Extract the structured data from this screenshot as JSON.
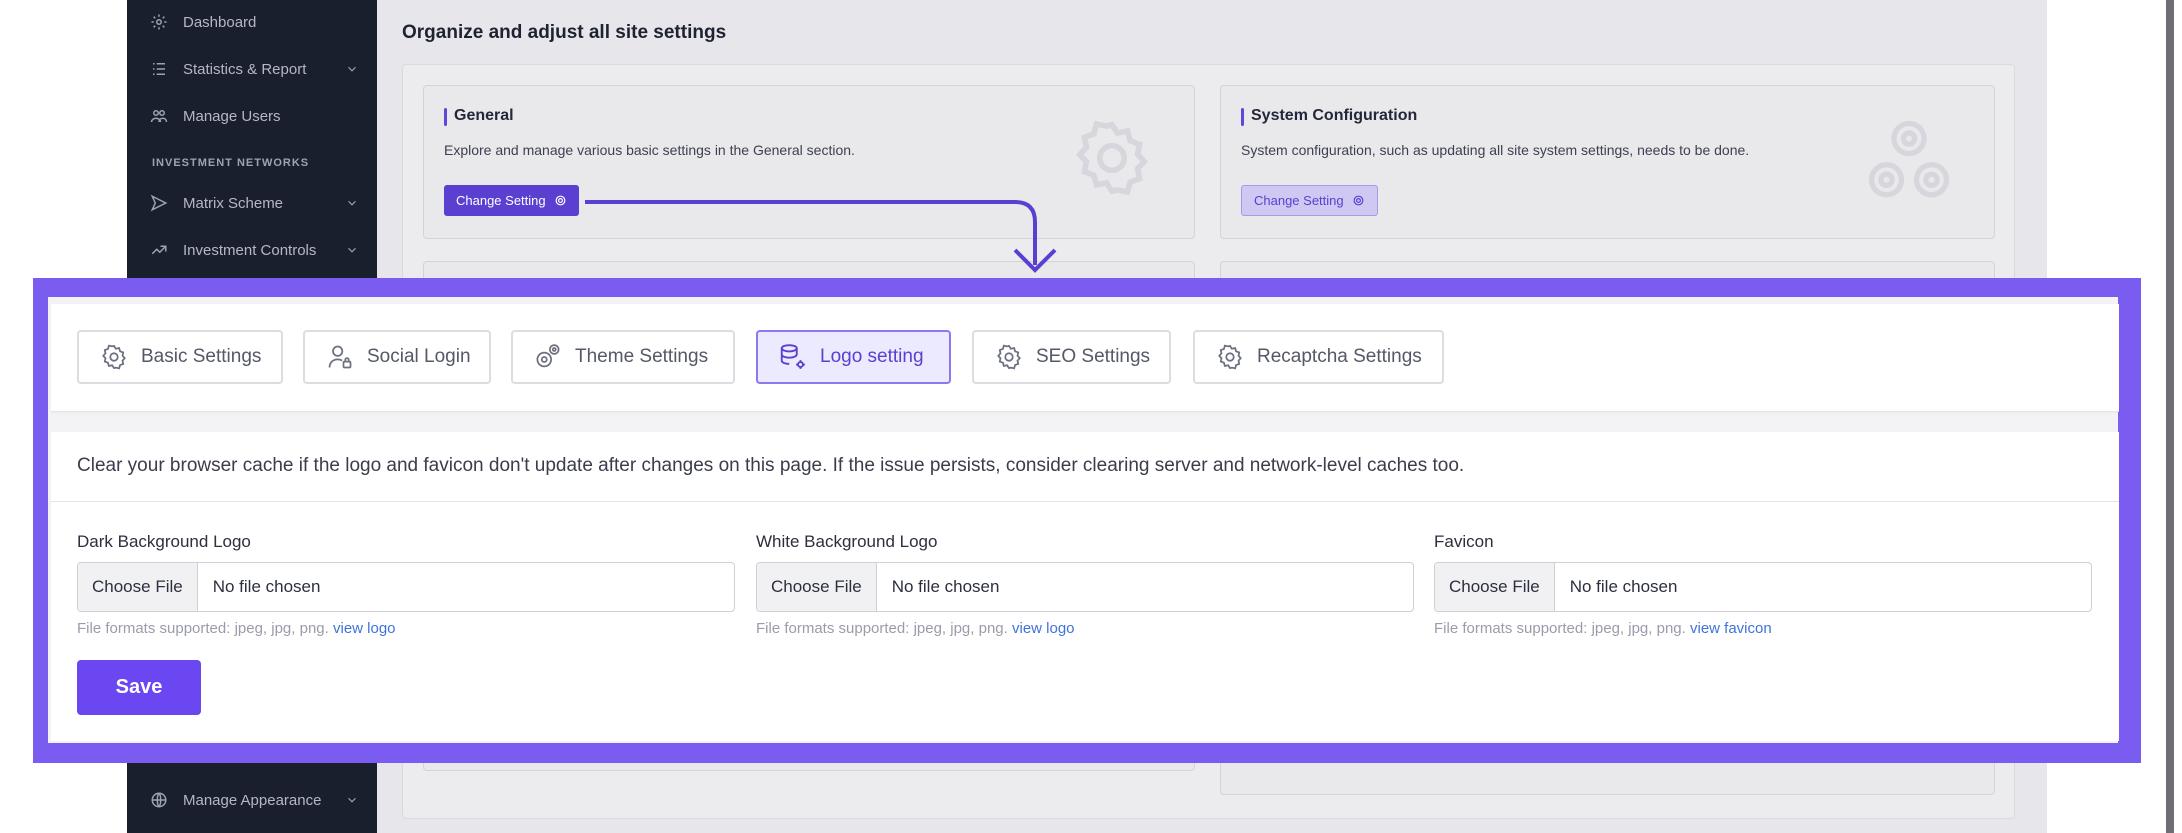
{
  "sidebar": {
    "items": [
      {
        "label": "Dashboard",
        "icon": "gear-icon",
        "chevron": false
      },
      {
        "label": "Statistics & Report",
        "icon": "list-icon",
        "chevron": true
      },
      {
        "label": "Manage Users",
        "icon": "users-icon",
        "chevron": false
      },
      {
        "label": "Matrix Scheme",
        "icon": "send-icon",
        "chevron": true
      },
      {
        "label": "Investment Controls",
        "icon": "investment-icon",
        "chevron": true
      },
      {
        "label": "Manage Appearance",
        "icon": "globe-icon",
        "chevron": true
      }
    ],
    "section_heading": "INVESTMENT NETWORKS"
  },
  "main": {
    "title": "Organize and adjust all site settings",
    "cards": [
      {
        "title": "General",
        "description": "Explore and manage various basic settings in the General section.",
        "button_label": "Change Setting",
        "icon": "gear-icon"
      },
      {
        "title": "System Configuration",
        "description": "System configuration, such as updating all site system settings, needs to be done.",
        "button_label": "Change Setting",
        "icon": "gears-icon"
      }
    ]
  },
  "settings": {
    "tabs": [
      {
        "label": "Basic Settings",
        "icon": "gear-icon",
        "active": false
      },
      {
        "label": "Social Login",
        "icon": "user-lock-icon",
        "active": false
      },
      {
        "label": "Theme Settings",
        "icon": "gears-icon",
        "active": false
      },
      {
        "label": "Logo setting",
        "icon": "database-gear-icon",
        "active": true
      },
      {
        "label": "SEO Settings",
        "icon": "gear-icon",
        "active": false
      },
      {
        "label": "Recaptcha Settings",
        "icon": "gear-icon",
        "active": false
      }
    ],
    "notice": "Clear your browser cache if the logo and favicon don't update after changes on this page. If the issue persists, consider clearing server and network-level caches too.",
    "fields": [
      {
        "label": "Dark Background Logo",
        "button": "Choose File",
        "status": "No file chosen",
        "help": "File formats supported: jpeg, jpg, png.",
        "link": "view logo"
      },
      {
        "label": "White Background Logo",
        "button": "Choose File",
        "status": "No file chosen",
        "help": "File formats supported: jpeg, jpg, png.",
        "link": "view logo"
      },
      {
        "label": "Favicon",
        "button": "Choose File",
        "status": "No file chosen",
        "help": "File formats supported: jpeg, jpg, png.",
        "link": "view favicon"
      }
    ],
    "save_label": "Save"
  },
  "colors": {
    "accent": "#6a47f0",
    "highlight_border": "#7b5cf0",
    "sidebar_bg": "#1a1f2e",
    "link": "#3f73d9"
  }
}
